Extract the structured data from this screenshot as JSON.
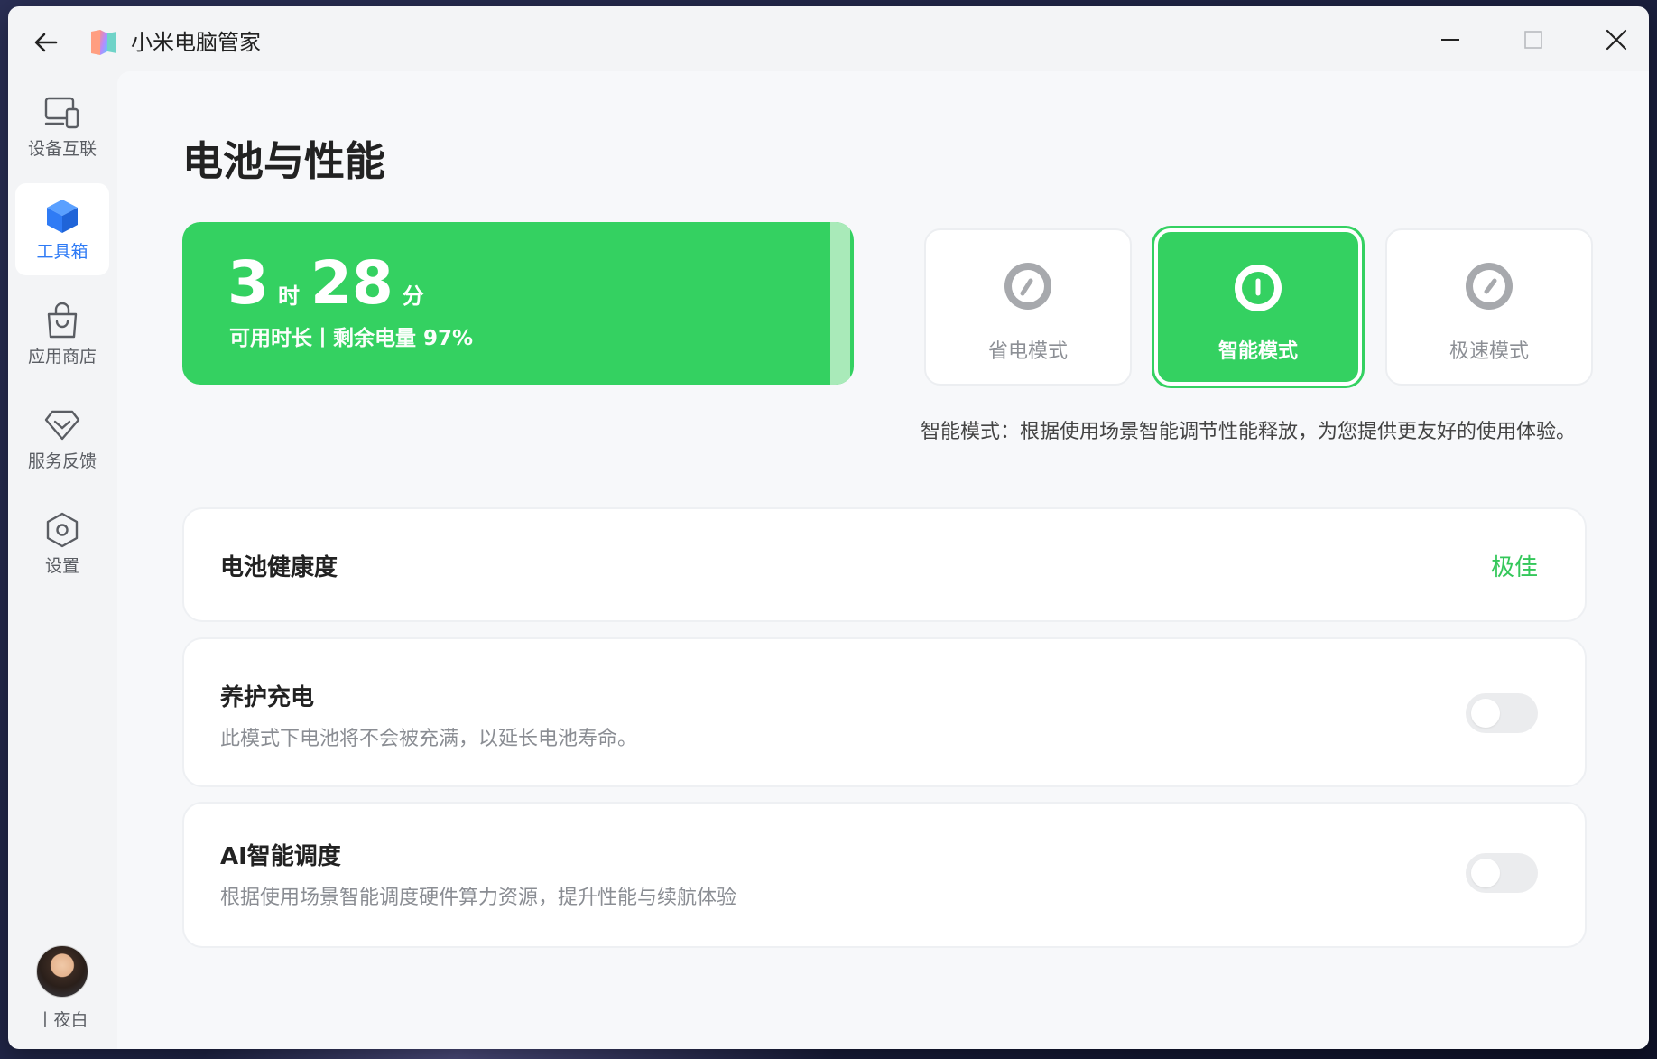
{
  "app": {
    "title": "小米电脑管家"
  },
  "sidebar": {
    "items": [
      {
        "label": "设备互联",
        "icon": "devices-icon",
        "active": false
      },
      {
        "label": "工具箱",
        "icon": "toolbox-cube-icon",
        "active": true
      },
      {
        "label": "应用商店",
        "icon": "shopping-bag-icon",
        "active": false
      },
      {
        "label": "服务反馈",
        "icon": "diamond-icon",
        "active": false
      },
      {
        "label": "设置",
        "icon": "settings-hexagon-icon",
        "active": false
      }
    ],
    "user": {
      "name": "丨夜白"
    }
  },
  "page": {
    "title": "电池与性能"
  },
  "battery": {
    "hours": "3",
    "hours_unit": "时",
    "minutes": "28",
    "minutes_unit": "分",
    "subtitle": "可用时长丨剩余电量 97%",
    "level_percent": 97
  },
  "modes": {
    "items": [
      {
        "label": "省电模式",
        "icon": "speedometer-low-icon",
        "active": false
      },
      {
        "label": "智能模式",
        "icon": "speedometer-mid-icon",
        "active": true
      },
      {
        "label": "极速模式",
        "icon": "speedometer-high-icon",
        "active": false
      }
    ],
    "description": "智能模式：根据使用场景智能调节性能释放，为您提供更友好的使用体验。"
  },
  "settings": {
    "battery_health": {
      "title": "电池健康度",
      "value": "极佳"
    },
    "care_charging": {
      "title": "养护充电",
      "desc": "此模式下电池将不会被充满，以延长电池寿命。",
      "enabled": false
    },
    "ai_scheduling": {
      "title": "AI智能调度",
      "desc": "根据使用场景智能调度硬件算力资源，提升性能与续航体验",
      "enabled": false
    }
  },
  "colors": {
    "accent_green": "#34d161",
    "accent_blue": "#2f7bf5",
    "health_value": "#34c75a"
  }
}
